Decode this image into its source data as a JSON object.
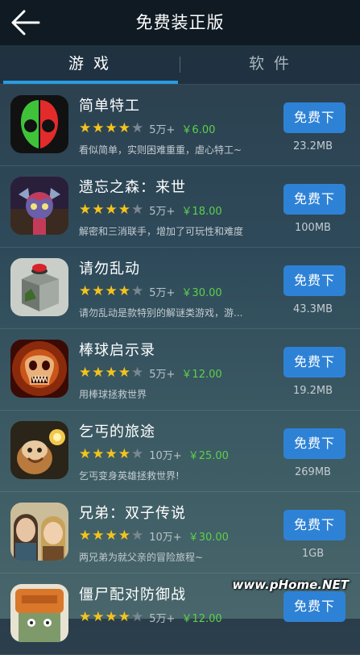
{
  "header": {
    "title": "免费装正版",
    "back_icon": "arrow-left-icon"
  },
  "tabs": [
    {
      "label": "游 戏",
      "active": true
    },
    {
      "label": "软 件",
      "active": false
    }
  ],
  "colors": {
    "accent": "#2a9be0",
    "button": "#2e82d6",
    "star": "#f4c31c",
    "price": "#5ad14a"
  },
  "apps": [
    {
      "name": "简单特工",
      "rating": 4,
      "downloads": "5万+",
      "price": "￥6.00",
      "desc": "看似简单，实则困难重重，虐心特工~",
      "size": "23.2MB",
      "button": "免费下"
    },
    {
      "name": "遗忘之森：来世",
      "rating": 4,
      "downloads": "5万+",
      "price": "￥18.00",
      "desc": "解密和三消联手，增加了可玩性和难度",
      "size": "100MB",
      "button": "免费下"
    },
    {
      "name": "请勿乱动",
      "rating": 4,
      "downloads": "5万+",
      "price": "￥30.00",
      "desc": "请勿乱动是款特别的解谜类游戏，游...",
      "size": "43.3MB",
      "button": "免费下"
    },
    {
      "name": "棒球启示录",
      "rating": 4,
      "downloads": "5万+",
      "price": "￥12.00",
      "desc": "用棒球拯救世界",
      "size": "19.2MB",
      "button": "免费下"
    },
    {
      "name": "乞丐的旅途",
      "rating": 4,
      "downloads": "10万+",
      "price": "￥25.00",
      "desc": "乞丐变身英雄拯救世界!",
      "size": "269MB",
      "button": "免费下"
    },
    {
      "name": "兄弟：双子传说",
      "rating": 4,
      "downloads": "10万+",
      "price": "￥30.00",
      "desc": "两兄弟为就父亲的冒险旅程~",
      "size": "1GB",
      "button": "免费下"
    },
    {
      "name": "僵尸配对防御战",
      "rating": 4,
      "downloads": "5万+",
      "price": "￥12.00",
      "desc": "",
      "size": "",
      "button": "免费下"
    }
  ],
  "watermark": "www.pHome.NET"
}
